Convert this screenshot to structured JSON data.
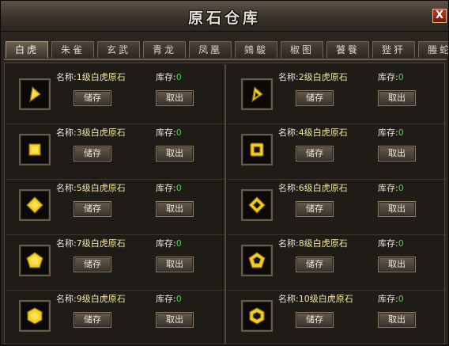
{
  "window": {
    "title": "原石仓库",
    "close_label": "X"
  },
  "tabs": [
    {
      "label": "白虎",
      "active": true
    },
    {
      "label": "朱雀"
    },
    {
      "label": "玄武"
    },
    {
      "label": "青龙"
    },
    {
      "label": "凤凰"
    },
    {
      "label": "鵕鵔"
    },
    {
      "label": "椒图"
    },
    {
      "label": "饕餮"
    },
    {
      "label": "狴犴"
    },
    {
      "label": "螣蛇"
    }
  ],
  "labels": {
    "name_prefix": "名称:",
    "stock_prefix": "库存:",
    "store_button": "储存",
    "take_button": "取出"
  },
  "items": [
    {
      "name": "1级白虎原石",
      "stock": "0",
      "icon": "triangle-gem-icon"
    },
    {
      "name": "2级白虎原石",
      "stock": "0",
      "icon": "triangle-gem-icon"
    },
    {
      "name": "3级白虎原石",
      "stock": "0",
      "icon": "square-gem-icon"
    },
    {
      "name": "4级白虎原石",
      "stock": "0",
      "icon": "square-gem-icon"
    },
    {
      "name": "5级白虎原石",
      "stock": "0",
      "icon": "diamond-gem-icon"
    },
    {
      "name": "6级白虎原石",
      "stock": "0",
      "icon": "diamond-gem-icon"
    },
    {
      "name": "7级白虎原石",
      "stock": "0",
      "icon": "pentagon-gem-icon"
    },
    {
      "name": "8级白虎原石",
      "stock": "0",
      "icon": "pentagon-gem-icon"
    },
    {
      "name": "9级白虎原石",
      "stock": "0",
      "icon": "hexagon-gem-icon"
    },
    {
      "name": "10级白虎原石",
      "stock": "0",
      "icon": "hexagon-gem-icon"
    }
  ],
  "colors": {
    "gem_gold": "#f2d21c",
    "stock_green": "#4fd04a",
    "close_red": "#b02a16"
  }
}
